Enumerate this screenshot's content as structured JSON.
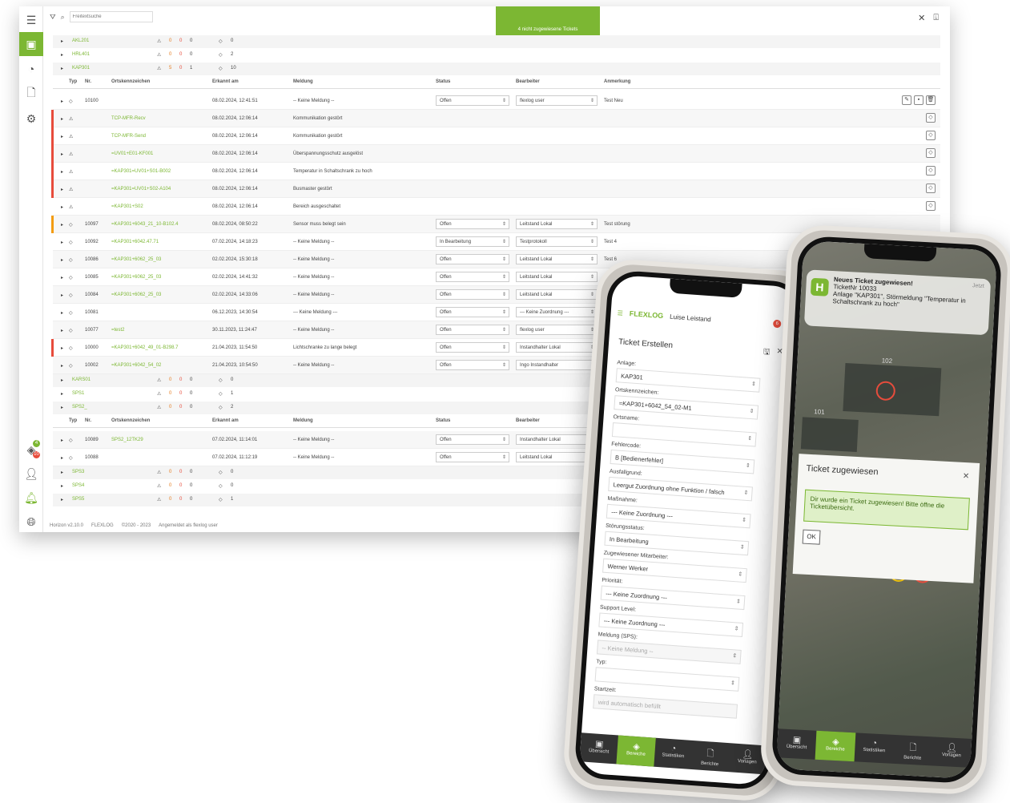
{
  "desktop": {
    "sidebar": {
      "badge_green": "4",
      "badge_red": "10"
    },
    "search": {
      "placeholder": "Freitextsuche"
    },
    "unassigned_label": "4 nicht zugewiesene Tickets",
    "groups_top": [
      {
        "name": "AKL201",
        "w1": "0",
        "w2": "0",
        "w3": "0",
        "t": "0"
      },
      {
        "name": "HRL401",
        "w1": "0",
        "w2": "0",
        "w3": "0",
        "t": "2"
      },
      {
        "name": "KAP301",
        "w1": "5",
        "w2": "0",
        "w3": "1",
        "t": "10"
      }
    ],
    "headers": {
      "typ": "Typ",
      "nr": "Nr.",
      "ort": "Ortskennzeichen",
      "erkannt": "Erkannt am",
      "meldung": "Meldung",
      "status": "Status",
      "bearbeiter": "Bearbeiter",
      "anmerkung": "Anmerkung"
    },
    "rows": [
      {
        "nr": "10100",
        "ort": "",
        "date": "08.02.2024, 12:41:51",
        "meldung": "-- Keine Meldung --",
        "status": "Offen",
        "bearb": "flexlog user",
        "anm": "Test Neu",
        "marker": "",
        "warn": false
      },
      {
        "nr": "",
        "ort": "TCP-MFR-Recv",
        "date": "08.02.2024, 12:06:14",
        "meldung": "Kommunikation gestört",
        "status": "",
        "bearb": "",
        "anm": "",
        "marker": "#e74c3c",
        "warn": true
      },
      {
        "nr": "",
        "ort": "TCP-MFR-Send",
        "date": "08.02.2024, 12:06:14",
        "meldung": "Kommunikation gestört",
        "status": "",
        "bearb": "",
        "anm": "",
        "marker": "#e74c3c",
        "warn": true
      },
      {
        "nr": "",
        "ort": "=UV01+E01-KF001",
        "date": "08.02.2024, 12:06:14",
        "meldung": "Überspannungsschutz ausgelöst",
        "status": "",
        "bearb": "",
        "anm": "",
        "marker": "#e74c3c",
        "warn": true
      },
      {
        "nr": "",
        "ort": "=KAP301=UV01+S01-B002",
        "date": "08.02.2024, 12:06:14",
        "meldung": "Temperatur in Schaltschrank zu hoch",
        "status": "",
        "bearb": "",
        "anm": "",
        "marker": "#e74c3c",
        "warn": true
      },
      {
        "nr": "",
        "ort": "=KAP301=UV01+S02-A104",
        "date": "08.02.2024, 12:06:14",
        "meldung": "Busmaster gestört",
        "status": "",
        "bearb": "",
        "anm": "",
        "marker": "#e74c3c",
        "warn": true
      },
      {
        "nr": "",
        "ort": "=KAP301+S02",
        "date": "08.02.2024, 12:06:14",
        "meldung": "Bereich ausgeschaltet",
        "status": "",
        "bearb": "",
        "anm": "",
        "marker": "",
        "warn": true
      },
      {
        "nr": "10097",
        "ort": "=KAP301+6043_21_10-B102.4",
        "date": "08.02.2024, 08:50:22",
        "meldung": "Sensor muss belegt sein",
        "status": "Offen",
        "bearb": "Leitstand Lokal",
        "anm": "Test störung",
        "marker": "#f39c12",
        "warn": false
      },
      {
        "nr": "10092",
        "ort": "=KAP301+6042.47.71",
        "date": "07.02.2024, 14:18:23",
        "meldung": "-- Keine Meldung --",
        "status": "In Bearbeitung",
        "bearb": "Testprotokoll",
        "anm": "Test 4",
        "marker": "",
        "warn": false
      },
      {
        "nr": "10086",
        "ort": "=KAP301+6062_25_03",
        "date": "02.02.2024, 15:30:18",
        "meldung": "-- Keine Meldung --",
        "status": "Offen",
        "bearb": "Leitstand Lokal",
        "anm": "Test 6",
        "marker": "",
        "warn": false
      },
      {
        "nr": "10085",
        "ort": "=KAP301+6062_25_03",
        "date": "02.02.2024, 14:41:32",
        "meldung": "-- Keine Meldung --",
        "status": "Offen",
        "bearb": "Leitstand Lokal",
        "anm": "",
        "marker": "",
        "warn": false
      },
      {
        "nr": "10084",
        "ort": "=KAP301+6062_25_03",
        "date": "02.02.2024, 14:33:06",
        "meldung": "-- Keine Meldung --",
        "status": "Offen",
        "bearb": "Leitstand Lokal",
        "anm": "",
        "marker": "",
        "warn": false
      },
      {
        "nr": "10081",
        "ort": "",
        "date": "06.12.2023, 14:30:54",
        "meldung": "--- Keine Meldung ---",
        "status": "Offen",
        "bearb": "--- Keine Zuordnung ---",
        "anm": "",
        "marker": "",
        "warn": false
      },
      {
        "nr": "10077",
        "ort": "=test2",
        "date": "30.11.2023, 11:24:47",
        "meldung": "-- Keine Meldung --",
        "status": "Offen",
        "bearb": "flexlog user",
        "anm": "",
        "marker": "",
        "warn": false
      },
      {
        "nr": "10000",
        "ort": "=KAP301+6042_49_01-B298.7",
        "date": "21.04.2023, 11:54:50",
        "meldung": "Lichtschranke zu lange belegt",
        "status": "Offen",
        "bearb": "Instandhalter Lokal",
        "anm": "",
        "marker": "#e74c3c",
        "warn": false
      },
      {
        "nr": "10002",
        "ort": "=KAP301+6042_54_02",
        "date": "21.04.2023, 10:54:50",
        "meldung": "-- Keine Meldung --",
        "status": "Offen",
        "bearb": "Ingo Instandhalter",
        "anm": "",
        "marker": "",
        "warn": false
      }
    ],
    "groups_mid": [
      {
        "name": "KARS01",
        "w1": "0",
        "w2": "0",
        "w3": "0",
        "t": "0"
      },
      {
        "name": "SPS1",
        "w1": "0",
        "w2": "0",
        "w3": "0",
        "t": "1"
      },
      {
        "name": "SPS2_",
        "w1": "0",
        "w2": "0",
        "w3": "0",
        "t": "2"
      }
    ],
    "rows2": [
      {
        "nr": "10089",
        "ort": "SPS2_12TK29",
        "date": "07.02.2024, 11:14:01",
        "meldung": "-- Keine Meldung --",
        "status": "Offen",
        "bearb": "Instandhalter Lokal"
      },
      {
        "nr": "10088",
        "ort": "",
        "date": "07.02.2024, 11:12:19",
        "meldung": "-- Keine Meldung --",
        "status": "Offen",
        "bearb": "Leitstand Lokal"
      }
    ],
    "groups_bottom": [
      {
        "name": "SPS3",
        "w1": "0",
        "w2": "0",
        "w3": "0",
        "t": "0"
      },
      {
        "name": "SPS4",
        "w1": "0",
        "w2": "0",
        "w3": "0",
        "t": "0"
      },
      {
        "name": "SPS5",
        "w1": "0",
        "w2": "0",
        "w3": "0",
        "t": "1"
      }
    ],
    "footer": {
      "version": "Horizon v2.10.0",
      "brand": "FLEXLOG",
      "copyright": "©2020 - 2023",
      "login": "Angemeldet als flexlog user"
    }
  },
  "phone1": {
    "brand": "FLEXLOG",
    "user": "Luise Leistand",
    "badge1": "6",
    "badge2": "20",
    "title": "Ticket Erstellen",
    "fields": [
      {
        "label": "Anlage:",
        "value": "KAP301"
      },
      {
        "label": "Ortskennzeichen:",
        "value": "=KAP301+6042_54_02-M1"
      },
      {
        "label": "Ortsname:",
        "value": ""
      },
      {
        "label": "Fehlercode:",
        "value": "B [Bedienerfehler]"
      },
      {
        "label": "Ausfallgrund:",
        "value": "Leergut Zuordnung ohne Funktion / falsch"
      },
      {
        "label": "Maßnahme:",
        "value": "--- Keine Zuordnung ---"
      },
      {
        "label": "Störungsstatus:",
        "value": "In Bearbeitung"
      },
      {
        "label": "Zugewiesener Mitarbeiter:",
        "value": "Werner Werker"
      },
      {
        "label": "Priorität:",
        "value": "--- Keine Zuordnung ---"
      },
      {
        "label": "Support Level:",
        "value": "--- Keine Zuordnung ---"
      },
      {
        "label": "Meldung (SPS):",
        "value": "-- Keine Meldung --"
      },
      {
        "label": "Typ:",
        "value": ""
      }
    ],
    "start_label": "Startzeit:",
    "start_value": "wird automatisch befüllt",
    "tabs": [
      "Übersicht",
      "Bereiche",
      "Statistiken",
      "Berichte",
      "Vorlagen"
    ]
  },
  "phone2": {
    "notif": {
      "app": "H",
      "title": "Neues Ticket zugewiesen!",
      "time": "Jetzt",
      "line1": "TicketNr 10033",
      "line2": "Anlage \"KAP301\", Störmeldung \"Temperatur in Schaltschrank zu hoch\""
    },
    "map_label_1": "102",
    "map_label_2": "101",
    "modal_title": "Ticket zugewiesen",
    "modal_text": "Dir wurde ein Ticket zugewiesen! Bitte öffne die Ticketübersicht.",
    "ok": "OK",
    "tabs": [
      "Übersicht",
      "Bereiche",
      "Statistiken",
      "Berichte",
      "Vorlagen"
    ]
  }
}
